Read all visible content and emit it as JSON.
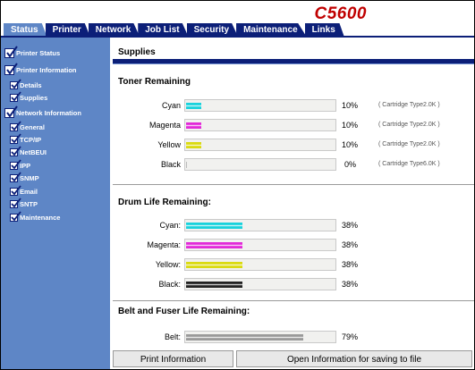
{
  "header": {
    "model": "C5600",
    "tabs": [
      {
        "label": "Status",
        "active": true
      },
      {
        "label": "Printer",
        "active": false
      },
      {
        "label": "Network",
        "active": false
      },
      {
        "label": "Job List",
        "active": false
      },
      {
        "label": "Security",
        "active": false
      },
      {
        "label": "Maintenance",
        "active": false
      },
      {
        "label": "Links",
        "active": false
      }
    ]
  },
  "sidebar": {
    "items": [
      {
        "label": "Printer Status",
        "level": 1
      },
      {
        "label": "Printer Information",
        "level": 1
      },
      {
        "label": "Details",
        "level": 2
      },
      {
        "label": "Supplies",
        "level": 2
      },
      {
        "label": "Network Information",
        "level": 1
      },
      {
        "label": "General",
        "level": 2
      },
      {
        "label": "TCP/IP",
        "level": 2
      },
      {
        "label": "NetBEUI",
        "level": 2
      },
      {
        "label": "IPP",
        "level": 2
      },
      {
        "label": "SNMP",
        "level": 2
      },
      {
        "label": "Email",
        "level": 2
      },
      {
        "label": "SNTP",
        "level": 2
      },
      {
        "label": "Maintenance",
        "level": 2
      }
    ]
  },
  "page": {
    "title": "Supplies",
    "toner": {
      "heading": "Toner Remaining",
      "rows": [
        {
          "label": "Cyan",
          "percent_text": "10%",
          "level": 0.1,
          "cartridge": "( Cartridge Type2.0K )",
          "color": "#19d2dc"
        },
        {
          "label": "Magenta",
          "percent_text": "10%",
          "level": 0.1,
          "cartridge": "( Cartridge Type2.0K )",
          "color": "#e22ad8"
        },
        {
          "label": "Yellow",
          "percent_text": "10%",
          "level": 0.1,
          "cartridge": "( Cartridge Type2.0K )",
          "color": "#dada10"
        },
        {
          "label": "Black",
          "percent_text": "0%",
          "level": 0.0,
          "cartridge": "( Cartridge Type6.0K )",
          "color": "#222222"
        }
      ]
    },
    "drum": {
      "heading": "Drum Life Remaining:",
      "rows": [
        {
          "label": "Cyan:",
          "percent_text": "38%",
          "level": 0.38,
          "color": "#19d2dc"
        },
        {
          "label": "Magenta:",
          "percent_text": "38%",
          "level": 0.38,
          "color": "#e22ad8"
        },
        {
          "label": "Yellow:",
          "percent_text": "38%",
          "level": 0.38,
          "color": "#dada10"
        },
        {
          "label": "Black:",
          "percent_text": "38%",
          "level": 0.38,
          "color": "#222222"
        }
      ]
    },
    "belt": {
      "heading": "Belt and Fuser Life Remaining:",
      "rows": [
        {
          "label": "Belt:",
          "percent_text": "79%",
          "level": 0.79,
          "color": "#9a9a9a"
        }
      ]
    }
  },
  "buttons": {
    "print_info": "Print Information",
    "open_info": "Open Information for saving to file"
  },
  "colors": {
    "accent_dark": "#0c1f78",
    "sidebar": "#5e86c6",
    "model_red": "#c00000"
  }
}
